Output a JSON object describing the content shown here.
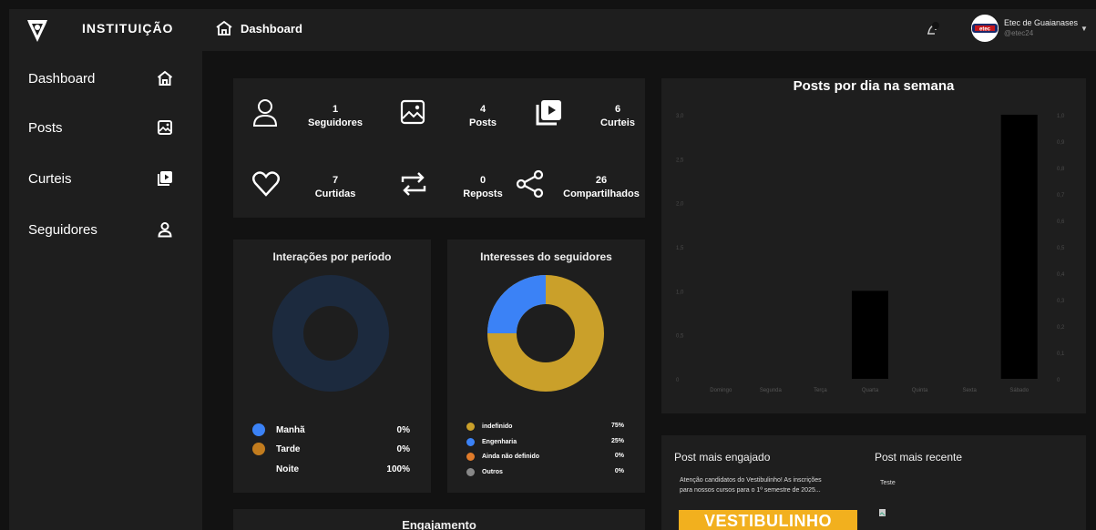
{
  "app": {
    "brand": "INSTITUIÇÃO",
    "breadcrumb": "Dashboard",
    "user": {
      "name": "Etec de Guaianases",
      "handle": "@etec24"
    }
  },
  "sidebar": {
    "items": [
      {
        "label": "Dashboard",
        "icon": "home-icon"
      },
      {
        "label": "Posts",
        "icon": "image-icon"
      },
      {
        "label": "Curteis",
        "icon": "video-icon"
      },
      {
        "label": "Seguidores",
        "icon": "user-icon"
      }
    ]
  },
  "stats": [
    {
      "value": "1",
      "label": "Seguidores",
      "icon": "user-icon"
    },
    {
      "value": "4",
      "label": "Posts",
      "icon": "image-icon"
    },
    {
      "value": "6",
      "label": "Curteis",
      "icon": "video-icon"
    },
    {
      "value": "7",
      "label": "Curtidas",
      "icon": "heart-icon"
    },
    {
      "value": "0",
      "label": "Reposts",
      "icon": "repost-icon"
    },
    {
      "value": "26",
      "label": "Compartilhados",
      "icon": "share-icon"
    }
  ],
  "interacoes": {
    "title": "Interações por período",
    "legend": [
      {
        "label": "Manhã",
        "value": "0%",
        "color": "#3b82f6"
      },
      {
        "label": "Tarde",
        "value": "0%",
        "color": "#c27c1e"
      },
      {
        "label": "Noite",
        "value": "100%",
        "color": "#1c2a3e"
      }
    ],
    "ring_color": "#1c2a3e"
  },
  "interesses": {
    "title": "Interesses do seguidores",
    "legend": [
      {
        "label": "indefinido",
        "value": "75%",
        "color": "#caa02a"
      },
      {
        "label": "Engenharia",
        "value": "25%",
        "color": "#3b82f6"
      },
      {
        "label": "Ainda não definido",
        "value": "0%",
        "color": "#e07b2a"
      },
      {
        "label": "Outros",
        "value": "0%",
        "color": "#888888"
      }
    ]
  },
  "engajamento": {
    "title": "Engajamento"
  },
  "chart_data": {
    "type": "bar",
    "title": "Posts por dia na semana",
    "categories": [
      "Domingo",
      "Segunda",
      "Terça",
      "Quarta",
      "Quinta",
      "Sexta",
      "Sábado"
    ],
    "values": [
      0,
      0,
      0,
      1,
      0,
      0,
      3
    ],
    "ylim": [
      0,
      3
    ],
    "left_ticks": [
      "3,0",
      "2,5",
      "2,0",
      "1,5",
      "1,0",
      "0,5",
      "0"
    ],
    "right_ticks": [
      "1,0",
      "0,9",
      "0,8",
      "0,7",
      "0,6",
      "0,5",
      "0,4",
      "0,3",
      "0,2",
      "0,1",
      "0"
    ],
    "bar_color": "#000000"
  },
  "posts": {
    "engajado_title": "Post mais engajado",
    "engajado_text_line1": "Atenção candidatos do Vestibulinho! As inscrições",
    "engajado_text_line2": "para nossos cursos para o 1º semestre de 2025...",
    "engajado_banner": "VESTIBULINHO",
    "recente_title": "Post mais recente",
    "recente_text": "Teste"
  }
}
